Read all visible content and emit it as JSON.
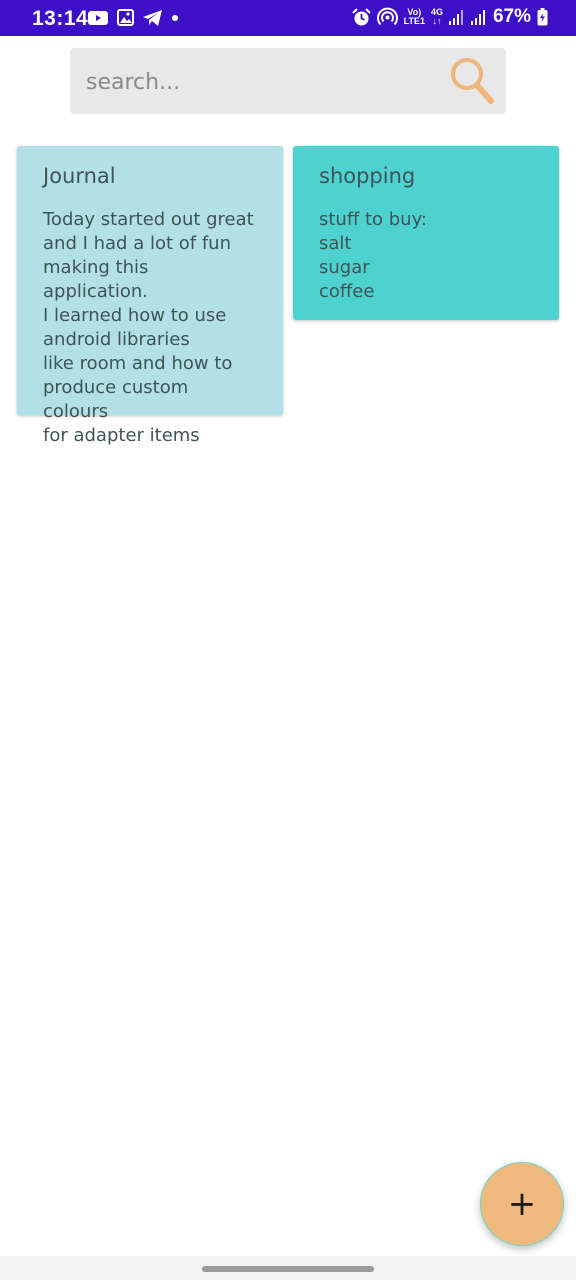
{
  "status_bar": {
    "time": "13:14",
    "battery_text": "67%",
    "volte_top": "Vo)",
    "volte_bottom": "LTE1",
    "network": "4G",
    "left_icons": [
      "youtube-icon",
      "gallery-icon",
      "telegram-icon",
      "dot-icon"
    ],
    "right_icons": [
      "alarm-icon",
      "hotspot-icon",
      "signal-icon",
      "signal-icon",
      "battery-icon"
    ]
  },
  "search": {
    "placeholder": "search..."
  },
  "notes": [
    {
      "title": "Journal",
      "body": "Today started out great\nand I had a lot of fun\nmaking this application.\nI learned how to use\nandroid libraries\nlike room and how to\nproduce custom colours\nfor adapter items",
      "color": "#b2e0e6"
    },
    {
      "title": "shopping",
      "body": "stuff to buy:\n salt\n sugar\ncoffee",
      "color": "#4dd2cf"
    }
  ],
  "fab": {
    "label": "+",
    "color": "#f0b97e"
  },
  "colors": {
    "status_bar": "#3d0fc7",
    "search_bg": "#e8e8e8",
    "search_icon": "#efb57a"
  }
}
